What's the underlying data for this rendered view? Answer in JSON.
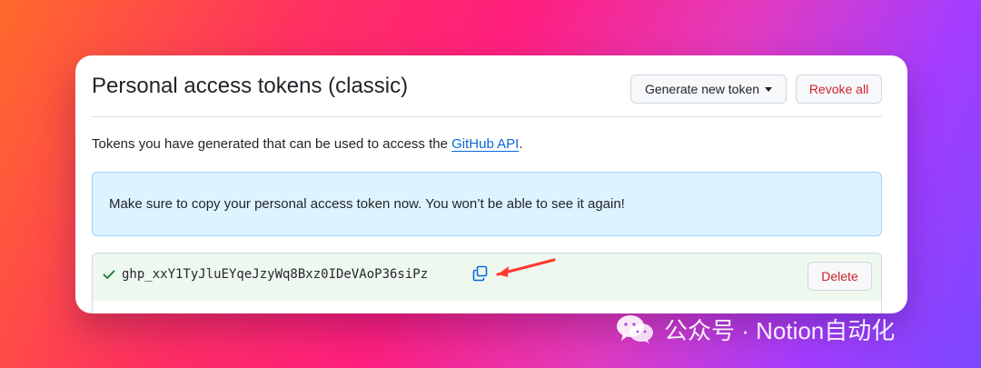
{
  "page": {
    "title": "Personal access tokens (classic)",
    "generate_button": "Generate new token",
    "revoke_button": "Revoke all",
    "description_prefix": "Tokens you have generated that can be used to access the ",
    "description_link": "GitHub API",
    "description_suffix": ".",
    "flash_message": "Make sure to copy your personal access token now. You won’t be able to see it again!",
    "token_value": "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",
    "delete_button": "Delete"
  },
  "watermark": {
    "text": "公众号 · Notion自动化"
  },
  "colors": {
    "danger": "#cf222e",
    "link": "#0969da",
    "success": "#1a7f37",
    "annotation_arrow": "#ff3b30",
    "flash_bg": "#ddf4ff",
    "token_row_bg": "#eef8ee"
  },
  "icons": {
    "caret": "triangle-down",
    "check": "checkmark",
    "copy": "copy-to-clipboard",
    "annotation": "red-arrow",
    "watermark_logo": "wechat-logo"
  }
}
